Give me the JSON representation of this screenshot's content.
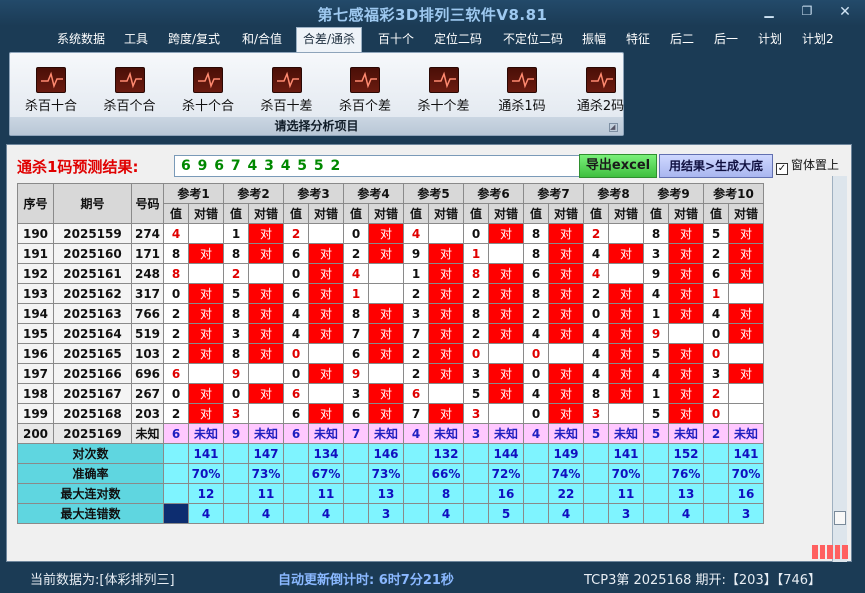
{
  "window": {
    "title": "第七感福彩3D排列三软件V8.81"
  },
  "menu": [
    "系统数据",
    "工具",
    "跨度/复式",
    "和/合值",
    "合差/通杀",
    "百十个",
    "定位二码",
    "不定位二码",
    "振幅",
    "特征",
    "后二",
    "后一",
    "计划",
    "计划2"
  ],
  "menu_active": 4,
  "ribbon": {
    "buttons": [
      "杀百十合",
      "杀百个合",
      "杀十个合",
      "杀百十差",
      "杀百个差",
      "杀十个差",
      "通杀1码",
      "通杀2码"
    ],
    "caption": "请选择分析项目"
  },
  "prediction": {
    "label": "通杀1码预测结果:",
    "value": "6 9 6 7 4 3 4 5 5 2",
    "excel_button": "导出excel",
    "generate_button": "用结果>生成大底",
    "topmost_label": "窗体置上"
  },
  "table": {
    "headers": {
      "idx": "序号",
      "period": "期号",
      "code": "号码",
      "val": "值",
      "result": "对错"
    },
    "refs": [
      "参考1",
      "参考2",
      "参考3",
      "参考4",
      "参考5",
      "参考6",
      "参考7",
      "参考8",
      "参考9",
      "参考10"
    ],
    "hit_text": "对",
    "unknown_text": "未知",
    "rows": [
      {
        "idx": "190",
        "period": "2025159",
        "code": "274",
        "vals": [
          "4",
          "1",
          "2",
          "0",
          "4",
          "0",
          "8",
          "2",
          "8",
          "5"
        ],
        "hits": [
          0,
          1,
          0,
          1,
          0,
          1,
          1,
          0,
          1,
          1
        ],
        "red": [
          1,
          0,
          1,
          0,
          1,
          0,
          0,
          1,
          0,
          0
        ]
      },
      {
        "idx": "191",
        "period": "2025160",
        "code": "171",
        "vals": [
          "8",
          "8",
          "6",
          "2",
          "9",
          "1",
          "8",
          "4",
          "3",
          "2"
        ],
        "hits": [
          1,
          1,
          1,
          1,
          1,
          0,
          1,
          1,
          1,
          1
        ],
        "red": [
          0,
          0,
          0,
          0,
          0,
          1,
          0,
          0,
          0,
          0
        ]
      },
      {
        "idx": "192",
        "period": "2025161",
        "code": "248",
        "vals": [
          "8",
          "2",
          "0",
          "4",
          "1",
          "8",
          "6",
          "4",
          "9",
          "6"
        ],
        "hits": [
          0,
          0,
          1,
          0,
          1,
          1,
          1,
          0,
          1,
          1
        ],
        "red": [
          1,
          1,
          0,
          1,
          0,
          1,
          0,
          1,
          0,
          0
        ]
      },
      {
        "idx": "193",
        "period": "2025162",
        "code": "317",
        "vals": [
          "0",
          "5",
          "6",
          "1",
          "2",
          "2",
          "8",
          "2",
          "4",
          "1"
        ],
        "hits": [
          1,
          1,
          1,
          0,
          1,
          1,
          1,
          1,
          1,
          0
        ],
        "red": [
          0,
          0,
          0,
          1,
          0,
          0,
          0,
          0,
          0,
          1
        ]
      },
      {
        "idx": "194",
        "period": "2025163",
        "code": "766",
        "vals": [
          "2",
          "8",
          "4",
          "8",
          "3",
          "8",
          "2",
          "0",
          "1",
          "4"
        ],
        "hits": [
          1,
          1,
          1,
          1,
          1,
          1,
          1,
          1,
          1,
          1
        ],
        "red": [
          0,
          0,
          0,
          0,
          0,
          0,
          0,
          0,
          0,
          0
        ]
      },
      {
        "idx": "195",
        "period": "2025164",
        "code": "519",
        "vals": [
          "2",
          "3",
          "4",
          "7",
          "7",
          "2",
          "4",
          "4",
          "9",
          "0"
        ],
        "hits": [
          1,
          1,
          1,
          1,
          1,
          1,
          1,
          1,
          0,
          1
        ],
        "red": [
          0,
          0,
          0,
          0,
          0,
          0,
          0,
          0,
          1,
          0
        ]
      },
      {
        "idx": "196",
        "period": "2025165",
        "code": "103",
        "vals": [
          "2",
          "8",
          "0",
          "6",
          "2",
          "0",
          "0",
          "4",
          "5",
          "0"
        ],
        "hits": [
          1,
          1,
          0,
          1,
          1,
          0,
          0,
          1,
          1,
          0
        ],
        "red": [
          0,
          0,
          1,
          0,
          0,
          1,
          1,
          0,
          0,
          1
        ]
      },
      {
        "idx": "197",
        "period": "2025166",
        "code": "696",
        "vals": [
          "6",
          "9",
          "0",
          "9",
          "2",
          "3",
          "0",
          "4",
          "4",
          "3"
        ],
        "hits": [
          0,
          0,
          1,
          0,
          1,
          1,
          1,
          1,
          1,
          1
        ],
        "red": [
          1,
          1,
          0,
          1,
          0,
          0,
          0,
          0,
          0,
          0
        ]
      },
      {
        "idx": "198",
        "period": "2025167",
        "code": "267",
        "vals": [
          "0",
          "0",
          "6",
          "3",
          "6",
          "5",
          "4",
          "8",
          "1",
          "2"
        ],
        "hits": [
          1,
          1,
          0,
          1,
          0,
          1,
          1,
          1,
          1,
          0
        ],
        "red": [
          0,
          0,
          1,
          0,
          1,
          0,
          0,
          0,
          0,
          1
        ]
      },
      {
        "idx": "199",
        "period": "2025168",
        "code": "203",
        "vals": [
          "2",
          "3",
          "6",
          "6",
          "7",
          "3",
          "0",
          "3",
          "5",
          "0"
        ],
        "hits": [
          1,
          0,
          1,
          1,
          1,
          0,
          1,
          0,
          1,
          0
        ],
        "red": [
          0,
          1,
          0,
          0,
          0,
          1,
          0,
          1,
          0,
          1
        ]
      }
    ],
    "pending": {
      "idx": "200",
      "period": "2025169",
      "code": "未知",
      "vals": [
        "6",
        "9",
        "6",
        "7",
        "4",
        "3",
        "4",
        "5",
        "5",
        "2"
      ]
    },
    "stats": [
      {
        "label": "对次数",
        "vals": [
          "141",
          "147",
          "134",
          "146",
          "132",
          "144",
          "149",
          "141",
          "152",
          "141"
        ]
      },
      {
        "label": "准确率",
        "vals": [
          "70%",
          "73%",
          "67%",
          "73%",
          "66%",
          "72%",
          "74%",
          "70%",
          "76%",
          "70%"
        ]
      },
      {
        "label": "最大连对数",
        "vals": [
          "12",
          "11",
          "11",
          "13",
          "8",
          "16",
          "22",
          "11",
          "13",
          "16"
        ]
      },
      {
        "label": "最大连错数",
        "vals": [
          "4",
          "4",
          "4",
          "3",
          "4",
          "5",
          "4",
          "3",
          "4",
          "3"
        ]
      }
    ]
  },
  "status": {
    "current_data": "当前数据为:[体彩排列三]",
    "countdown": "自动更新倒计时: 6时7分21秒",
    "draw_info": "TCP3第 2025168 期开:【203】【746】"
  },
  "colors": {
    "hit": "#ff0000",
    "stat_bg": "#7ff4ff",
    "pending_bg": "#ffc8ff",
    "title": "#9ec9f0"
  }
}
